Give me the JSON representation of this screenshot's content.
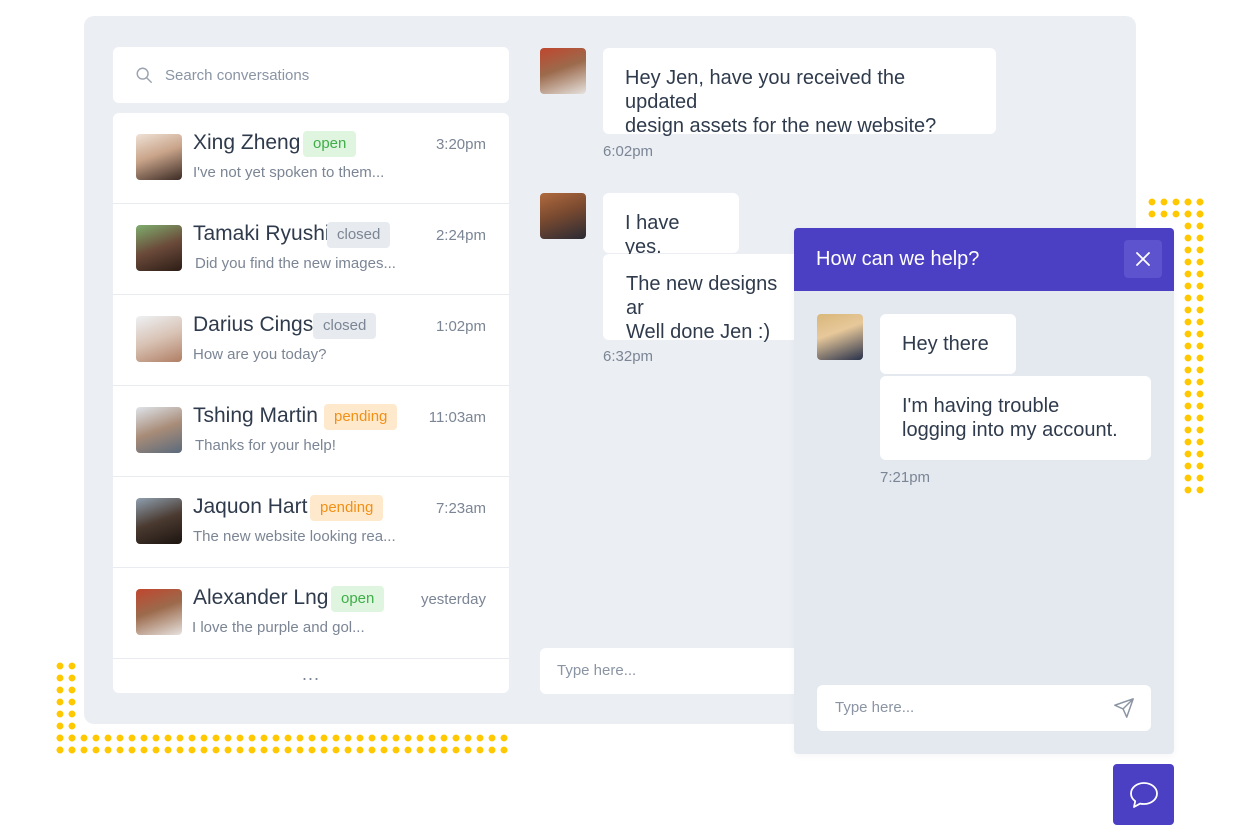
{
  "search": {
    "placeholder": "Search conversations"
  },
  "conversations": [
    {
      "name": "Xing Zheng",
      "status": "open",
      "time": "3:20pm",
      "preview": "I've not yet spoken to them...",
      "avatar_color": "#c9a48a"
    },
    {
      "name": "Tamaki Ryushi",
      "status": "closed",
      "time": "2:24pm",
      "preview": "Did you find the new images...",
      "avatar_color": "#6b4a3a"
    },
    {
      "name": "Darius Cings",
      "status": "closed",
      "time": "1:02pm",
      "preview": "How are you today?",
      "avatar_color": "#d8c2b4"
    },
    {
      "name": "Tshing Martin",
      "status": "pending",
      "time": "11:03am",
      "preview": "Thanks for your help!",
      "avatar_color": "#a88c78"
    },
    {
      "name": "Jaquon Hart",
      "status": "pending",
      "time": "7:23am",
      "preview": "The new website looking rea...",
      "avatar_color": "#4a3a30"
    },
    {
      "name": "Alexander Lng",
      "status": "open",
      "time": "yesterday",
      "preview": "I love the purple and gol...",
      "avatar_color": "#9c6a4c"
    }
  ],
  "more": "...",
  "thread": {
    "messages": [
      {
        "text_line1": "Hey Jen, have you received the updated",
        "text_line2": "design assets for the new website?",
        "time": "6:02pm"
      },
      {
        "text": "I have yes.",
        "text_b_line1": "The new designs ar",
        "text_b_line2": "Well done Jen :)",
        "time": "6:32pm"
      }
    ],
    "input_placeholder": "Type here..."
  },
  "widget": {
    "title": "How can we help?",
    "close_icon": "close-icon",
    "messages": [
      "Hey there",
      "I'm having trouble",
      "logging into my account."
    ],
    "time": "7:21pm",
    "input_placeholder": "Type here...",
    "send_icon": "send-icon"
  },
  "launcher_icon": "chat-bubble-icon",
  "colors": {
    "brand_purple": "#4b3fc4",
    "accent_yellow": "#ffc800",
    "open_green": "#3fae49",
    "pending_orange": "#f29014",
    "closed_gray": "#7b8594"
  }
}
